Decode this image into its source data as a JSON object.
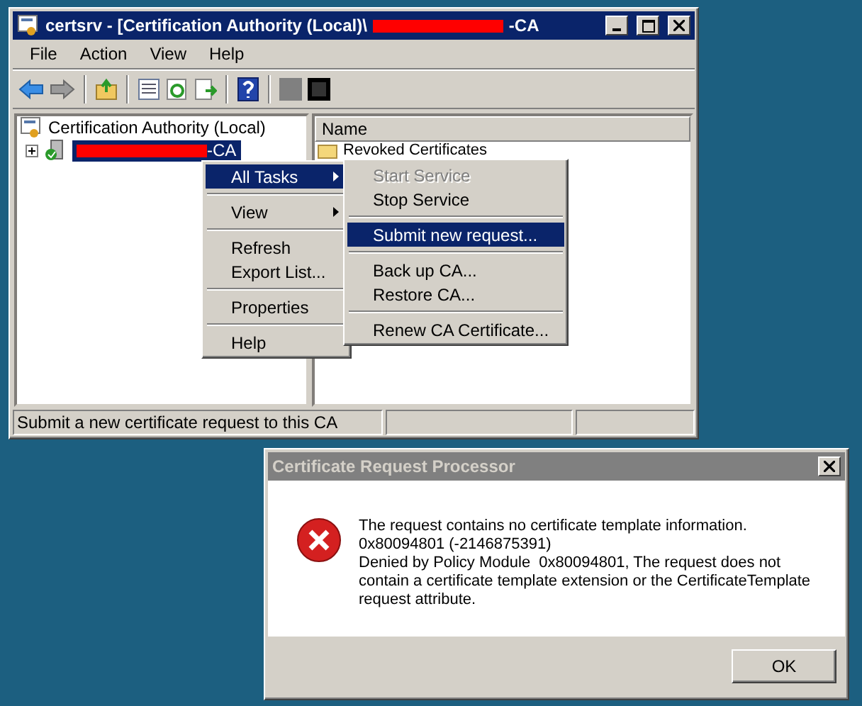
{
  "main_window": {
    "active": true,
    "title_prefix": "certsrv - [Certification Authority (Local)\\",
    "title_suffix": "-CA",
    "menu": [
      "File",
      "Action",
      "View",
      "Help"
    ],
    "tree": {
      "root": "Certification Authority (Local)",
      "children": [
        {
          "label_suffix": "-CA",
          "selected": true,
          "expanded": false
        }
      ]
    },
    "list": {
      "columns": [
        "Name"
      ],
      "rows": [
        "Revoked Certificates"
      ]
    },
    "status_bar": [
      "Submit a new certificate request to this CA"
    ]
  },
  "context_menu": {
    "items": [
      {
        "kind": "item",
        "label": "All Tasks",
        "submenu": true,
        "selected": true,
        "disabled": false
      },
      {
        "kind": "separator"
      },
      {
        "kind": "item",
        "label": "View",
        "submenu": true,
        "selected": false,
        "disabled": false
      },
      {
        "kind": "separator"
      },
      {
        "kind": "item",
        "label": "Refresh",
        "submenu": false,
        "selected": false,
        "disabled": false
      },
      {
        "kind": "item",
        "label": "Export List...",
        "submenu": false,
        "selected": false,
        "disabled": false
      },
      {
        "kind": "separator"
      },
      {
        "kind": "item",
        "label": "Properties",
        "submenu": false,
        "selected": false,
        "disabled": false
      },
      {
        "kind": "separator"
      },
      {
        "kind": "item",
        "label": "Help",
        "submenu": false,
        "selected": false,
        "disabled": false
      }
    ]
  },
  "submenu": {
    "items": [
      {
        "kind": "item",
        "label": "Start Service",
        "selected": false,
        "disabled": true
      },
      {
        "kind": "item",
        "label": "Stop Service",
        "selected": false,
        "disabled": false
      },
      {
        "kind": "separator"
      },
      {
        "kind": "item",
        "label": "Submit new request...",
        "selected": true,
        "disabled": false
      },
      {
        "kind": "separator"
      },
      {
        "kind": "item",
        "label": "Back up CA...",
        "selected": false,
        "disabled": false
      },
      {
        "kind": "item",
        "label": "Restore CA...",
        "selected": false,
        "disabled": false
      },
      {
        "kind": "separator"
      },
      {
        "kind": "item",
        "label": "Renew CA Certificate...",
        "selected": false,
        "disabled": false
      }
    ]
  },
  "dialog": {
    "active": false,
    "title": "Certificate Request Processor",
    "message_lines": [
      "The request contains no certificate template information.",
      "0x80094801 (-2146875391)",
      "Denied by Policy Module  0x80094801, The request does not",
      "contain a certificate template extension or the CertificateTemplate",
      "request attribute."
    ],
    "buttons": [
      "OK"
    ]
  }
}
